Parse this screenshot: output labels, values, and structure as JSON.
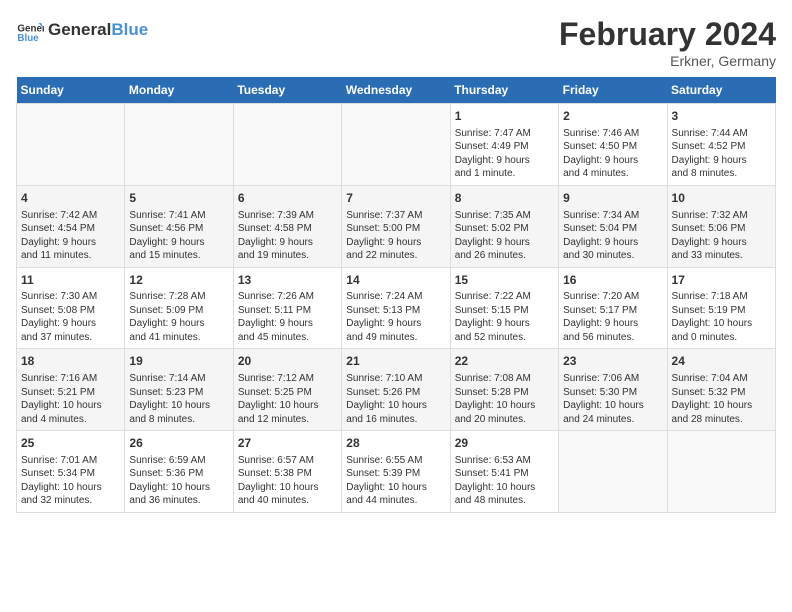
{
  "header": {
    "logo_general": "General",
    "logo_blue": "Blue",
    "title": "February 2024",
    "subtitle": "Erkner, Germany"
  },
  "calendar": {
    "weekdays": [
      "Sunday",
      "Monday",
      "Tuesday",
      "Wednesday",
      "Thursday",
      "Friday",
      "Saturday"
    ],
    "weeks": [
      [
        {
          "day": "",
          "info": ""
        },
        {
          "day": "",
          "info": ""
        },
        {
          "day": "",
          "info": ""
        },
        {
          "day": "",
          "info": ""
        },
        {
          "day": "1",
          "info": "Sunrise: 7:47 AM\nSunset: 4:49 PM\nDaylight: 9 hours\nand 1 minute."
        },
        {
          "day": "2",
          "info": "Sunrise: 7:46 AM\nSunset: 4:50 PM\nDaylight: 9 hours\nand 4 minutes."
        },
        {
          "day": "3",
          "info": "Sunrise: 7:44 AM\nSunset: 4:52 PM\nDaylight: 9 hours\nand 8 minutes."
        }
      ],
      [
        {
          "day": "4",
          "info": "Sunrise: 7:42 AM\nSunset: 4:54 PM\nDaylight: 9 hours\nand 11 minutes."
        },
        {
          "day": "5",
          "info": "Sunrise: 7:41 AM\nSunset: 4:56 PM\nDaylight: 9 hours\nand 15 minutes."
        },
        {
          "day": "6",
          "info": "Sunrise: 7:39 AM\nSunset: 4:58 PM\nDaylight: 9 hours\nand 19 minutes."
        },
        {
          "day": "7",
          "info": "Sunrise: 7:37 AM\nSunset: 5:00 PM\nDaylight: 9 hours\nand 22 minutes."
        },
        {
          "day": "8",
          "info": "Sunrise: 7:35 AM\nSunset: 5:02 PM\nDaylight: 9 hours\nand 26 minutes."
        },
        {
          "day": "9",
          "info": "Sunrise: 7:34 AM\nSunset: 5:04 PM\nDaylight: 9 hours\nand 30 minutes."
        },
        {
          "day": "10",
          "info": "Sunrise: 7:32 AM\nSunset: 5:06 PM\nDaylight: 9 hours\nand 33 minutes."
        }
      ],
      [
        {
          "day": "11",
          "info": "Sunrise: 7:30 AM\nSunset: 5:08 PM\nDaylight: 9 hours\nand 37 minutes."
        },
        {
          "day": "12",
          "info": "Sunrise: 7:28 AM\nSunset: 5:09 PM\nDaylight: 9 hours\nand 41 minutes."
        },
        {
          "day": "13",
          "info": "Sunrise: 7:26 AM\nSunset: 5:11 PM\nDaylight: 9 hours\nand 45 minutes."
        },
        {
          "day": "14",
          "info": "Sunrise: 7:24 AM\nSunset: 5:13 PM\nDaylight: 9 hours\nand 49 minutes."
        },
        {
          "day": "15",
          "info": "Sunrise: 7:22 AM\nSunset: 5:15 PM\nDaylight: 9 hours\nand 52 minutes."
        },
        {
          "day": "16",
          "info": "Sunrise: 7:20 AM\nSunset: 5:17 PM\nDaylight: 9 hours\nand 56 minutes."
        },
        {
          "day": "17",
          "info": "Sunrise: 7:18 AM\nSunset: 5:19 PM\nDaylight: 10 hours\nand 0 minutes."
        }
      ],
      [
        {
          "day": "18",
          "info": "Sunrise: 7:16 AM\nSunset: 5:21 PM\nDaylight: 10 hours\nand 4 minutes."
        },
        {
          "day": "19",
          "info": "Sunrise: 7:14 AM\nSunset: 5:23 PM\nDaylight: 10 hours\nand 8 minutes."
        },
        {
          "day": "20",
          "info": "Sunrise: 7:12 AM\nSunset: 5:25 PM\nDaylight: 10 hours\nand 12 minutes."
        },
        {
          "day": "21",
          "info": "Sunrise: 7:10 AM\nSunset: 5:26 PM\nDaylight: 10 hours\nand 16 minutes."
        },
        {
          "day": "22",
          "info": "Sunrise: 7:08 AM\nSunset: 5:28 PM\nDaylight: 10 hours\nand 20 minutes."
        },
        {
          "day": "23",
          "info": "Sunrise: 7:06 AM\nSunset: 5:30 PM\nDaylight: 10 hours\nand 24 minutes."
        },
        {
          "day": "24",
          "info": "Sunrise: 7:04 AM\nSunset: 5:32 PM\nDaylight: 10 hours\nand 28 minutes."
        }
      ],
      [
        {
          "day": "25",
          "info": "Sunrise: 7:01 AM\nSunset: 5:34 PM\nDaylight: 10 hours\nand 32 minutes."
        },
        {
          "day": "26",
          "info": "Sunrise: 6:59 AM\nSunset: 5:36 PM\nDaylight: 10 hours\nand 36 minutes."
        },
        {
          "day": "27",
          "info": "Sunrise: 6:57 AM\nSunset: 5:38 PM\nDaylight: 10 hours\nand 40 minutes."
        },
        {
          "day": "28",
          "info": "Sunrise: 6:55 AM\nSunset: 5:39 PM\nDaylight: 10 hours\nand 44 minutes."
        },
        {
          "day": "29",
          "info": "Sunrise: 6:53 AM\nSunset: 5:41 PM\nDaylight: 10 hours\nand 48 minutes."
        },
        {
          "day": "",
          "info": ""
        },
        {
          "day": "",
          "info": ""
        }
      ]
    ]
  }
}
